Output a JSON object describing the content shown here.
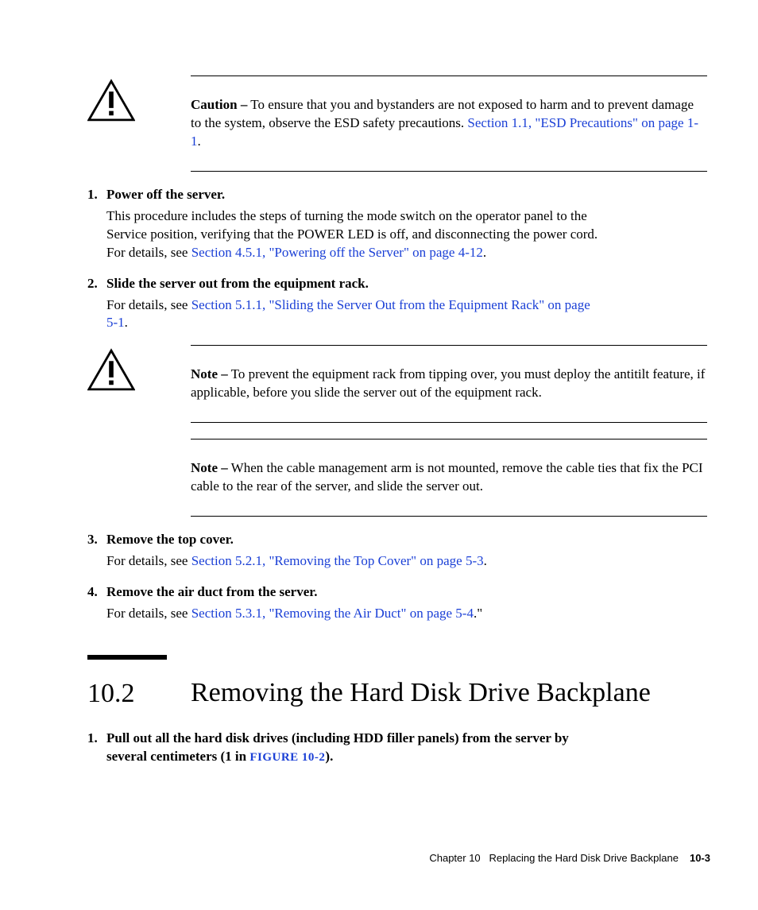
{
  "caution": {
    "label": "Caution –",
    "text_a": " To ensure that you and bystanders are not exposed to harm and to prevent damage to the system, observe the ESD safety precautions. ",
    "link": "Section 1.1, \"ESD Precautions\" on page 1-1",
    "text_b": "."
  },
  "steps1": [
    {
      "num": "1.",
      "title": "Power off the server.",
      "body_a": "This procedure includes the steps of turning the mode switch on the operator panel to the Service position, verifying that the POWER LED is off, and disconnecting the power cord. For details, see ",
      "link": "Section 4.5.1, \"Powering off the Server\" on page 4-12",
      "body_b": "."
    },
    {
      "num": "2.",
      "title": "Slide the server out from the equipment rack.",
      "body_a": "For details, see ",
      "link": "Section 5.1.1, \"Sliding the Server Out from the Equipment Rack\" on page 5-1",
      "body_b": "."
    }
  ],
  "note1": {
    "label": "Note –",
    "text": " To prevent the equipment rack from tipping over, you must deploy the antitilt feature, if applicable, before you slide the server out of the equipment rack."
  },
  "note2": {
    "label": "Note –",
    "text": " When the cable management arm is not mounted, remove the cable ties that fix the PCI cable to the rear of the server, and slide the server out."
  },
  "steps2": [
    {
      "num": "3.",
      "title": "Remove the top cover.",
      "body_a": "For details, see ",
      "link": "Section 5.2.1, \"Removing the Top Cover\" on page 5-3",
      "body_b": "."
    },
    {
      "num": "4.",
      "title": "Remove the air duct from the server.",
      "body_a": "For details, see ",
      "link": "Section 5.3.1, \"Removing the Air Duct\" on page 5-4",
      "body_b": ".\""
    }
  ],
  "section": {
    "num": "10.2",
    "title": "Removing the Hard Disk Drive Backplane"
  },
  "steps3": [
    {
      "num": "1.",
      "title_a": "Pull out all the hard disk drives (including HDD filler panels) from the server by several centimeters (1 in ",
      "link": "FIGURE 10-2",
      "title_b": ")."
    }
  ],
  "footer": {
    "chapter": "Chapter 10",
    "title": "Replacing the Hard Disk Drive Backplane",
    "page": "10-3"
  }
}
